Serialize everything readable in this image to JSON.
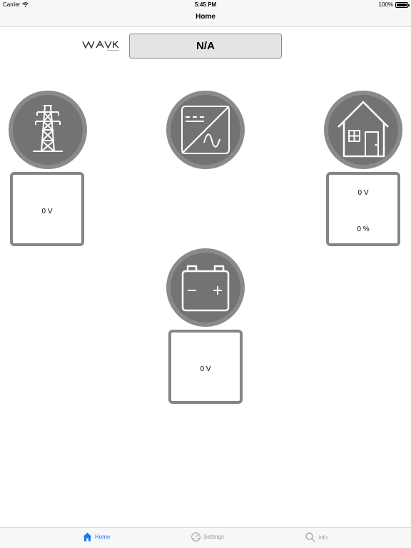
{
  "status_bar": {
    "carrier": "Carrier",
    "time": "5:45 PM",
    "battery": "100%"
  },
  "nav": {
    "title": "Home"
  },
  "device": {
    "status": "N/A"
  },
  "grid": {
    "voltage": "0 V"
  },
  "load": {
    "voltage": "0 V",
    "percent": "0 %"
  },
  "battery": {
    "voltage": "0 V"
  },
  "tabs": [
    {
      "label": "Home",
      "icon": "house-icon",
      "active": true
    },
    {
      "label": "Settings",
      "icon": "gauge-icon",
      "active": false
    },
    {
      "label": "Info",
      "icon": "search-icon",
      "active": false
    }
  ],
  "colors": {
    "accent": "#1a7cf5",
    "node_outer": "#8a8a8a",
    "node_inner": "#737373",
    "box_border": "#858585"
  }
}
